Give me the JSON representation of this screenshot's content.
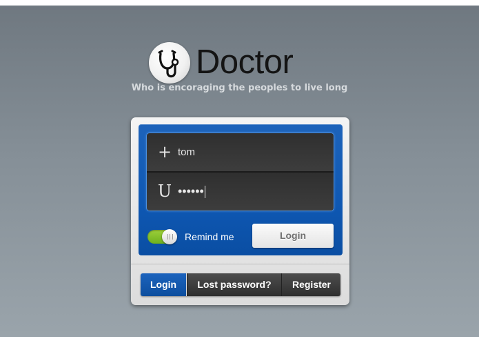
{
  "brand": {
    "name": "Doctor",
    "tagline": "Who is encoraging the peoples to live long",
    "logo_icon": "stethoscope-icon"
  },
  "login_form": {
    "username": {
      "icon": "+",
      "value": "tom"
    },
    "password": {
      "icon": "U",
      "value": "••••••"
    },
    "remember": {
      "label": "Remind me",
      "checked": true
    },
    "submit_label": "Login"
  },
  "tabs": [
    {
      "label": "Login",
      "active": true
    },
    {
      "label": "Lost password?",
      "active": false
    },
    {
      "label": "Register",
      "active": false
    }
  ],
  "colors": {
    "accent_blue": "#0f58b3",
    "toggle_green": "#7cbb26",
    "background": "#858f97"
  }
}
